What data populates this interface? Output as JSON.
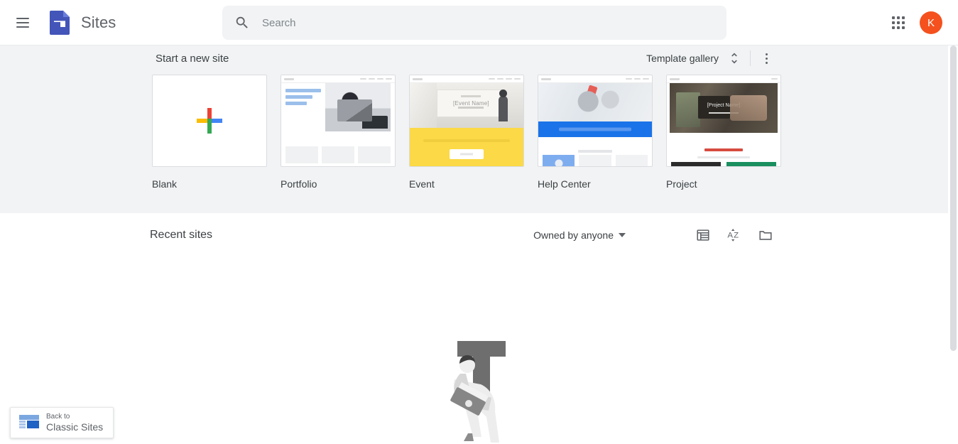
{
  "header": {
    "menu_icon": "hamburger-menu-icon",
    "logo_icon": "google-sites-logo",
    "title": "Sites",
    "search": {
      "icon": "search-icon",
      "placeholder": "Search",
      "value": ""
    },
    "apps_icon": "apps-grid-icon",
    "avatar": {
      "initial": "K",
      "color": "#f4511e"
    }
  },
  "new_site": {
    "title": "Start a new site",
    "template_gallery_label": "Template gallery",
    "expand_icon": "chevron-expand-icon",
    "more_icon": "more-vert-icon",
    "templates": [
      {
        "label": "Blank",
        "kind": "blank"
      },
      {
        "label": "Portfolio",
        "kind": "portfolio"
      },
      {
        "label": "Event",
        "kind": "event"
      },
      {
        "label": "Help Center",
        "kind": "help-center"
      },
      {
        "label": "Project",
        "kind": "project"
      }
    ],
    "event_preview_text": "[Event Name]",
    "project_preview_text": "[Project Name]"
  },
  "recent": {
    "title": "Recent sites",
    "owner_filter": "Owned by anyone",
    "owner_caret_icon": "caret-down-icon",
    "view_list_icon": "list-view-icon",
    "sort_az_icon": "sort-az-icon",
    "folder_icon": "folder-icon",
    "empty_illustration": "person-carrying-letter-t-illustration"
  },
  "classic_sites": {
    "icon": "classic-sites-icon",
    "line1": "Back to",
    "line2": "Classic Sites"
  },
  "colors": {
    "accent_blue": "#1a73e8",
    "panel_grey": "#f1f3f4",
    "text_primary": "#3c4043",
    "event_yellow": "#fcd946",
    "project_red": "#d64b3f"
  }
}
